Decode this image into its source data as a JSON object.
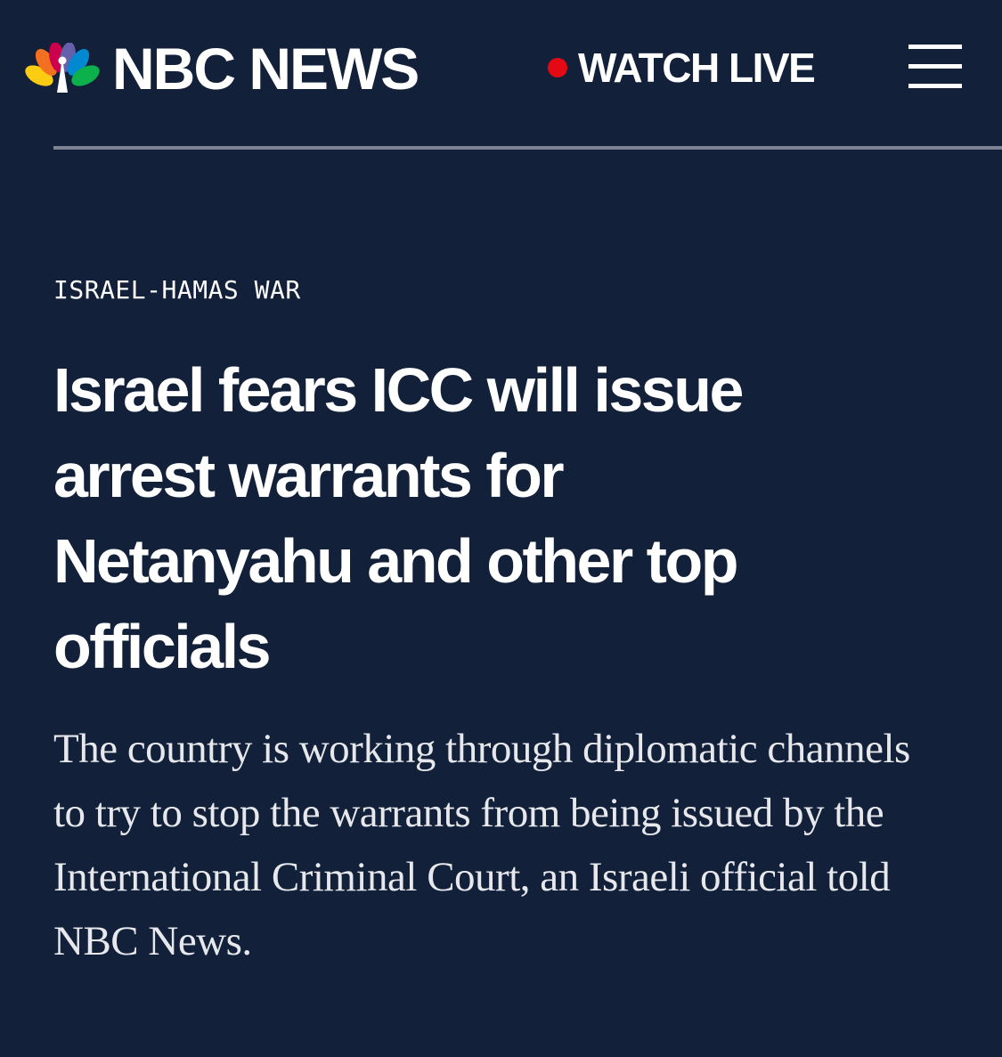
{
  "brand": {
    "name": "NBC NEWS",
    "logo_icon": "peacock-icon",
    "colors": {
      "background": "#122039",
      "live_dot": "#e50914",
      "peacock": [
        "#fccc12",
        "#f37021",
        "#cc004c",
        "#6460aa",
        "#0089d0",
        "#0db14b"
      ]
    }
  },
  "header": {
    "watch_live_label": "WATCH LIVE",
    "menu_icon": "hamburger-menu-icon"
  },
  "article": {
    "category": "ISRAEL-HAMAS WAR",
    "headline": "Israel fears ICC will issue arrest warrants for Netanyahu and other top officials",
    "dek": "The country is working through diplomatic channels to try to stop the warrants from being issued by the International Criminal Court, an Israeli official told NBC News."
  }
}
